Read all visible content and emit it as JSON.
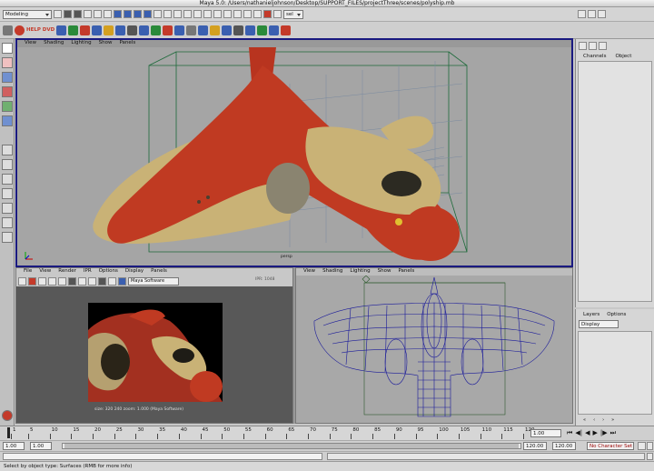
{
  "window": {
    "title": "Maya 5.0: /Users/nathanieljohnson/Desktop/SUPPORT_FILES/projectThree/scenes/polyship.mb"
  },
  "status_line": {
    "mode": "Modeling",
    "select_field": "sel"
  },
  "shelf": {
    "label": "HELP DVD"
  },
  "persp_panel": {
    "menus": [
      "View",
      "Shading",
      "Lighting",
      "Show",
      "Panels"
    ],
    "camera_label": "persp"
  },
  "render_panel": {
    "menus": [
      "File",
      "View",
      "Render",
      "IPR",
      "Options",
      "Display",
      "Panels"
    ],
    "renderer": "Maya Software",
    "ipr_label": "IPR: 1048",
    "caption": "size: 320 240 zoom: 1.000 (Maya Software)"
  },
  "front_panel": {
    "menus": [
      "View",
      "Shading",
      "Lighting",
      "Show",
      "Panels"
    ]
  },
  "channel_box": {
    "tabs": [
      "Channels",
      "Object"
    ]
  },
  "layers": {
    "tabs": [
      "Layers",
      "Options"
    ],
    "display": "Display"
  },
  "timeline": {
    "ticks": [
      "1",
      "5",
      "10",
      "15",
      "20",
      "25",
      "30",
      "35",
      "40",
      "45",
      "50",
      "55",
      "60",
      "65",
      "70",
      "75",
      "80",
      "85",
      "90",
      "95",
      "100",
      "105",
      "110",
      "115",
      "120"
    ],
    "current_frame": "1.00"
  },
  "range": {
    "start": "1.00",
    "inner_start": "1.00",
    "inner_end": "120.00",
    "end": "120.00",
    "char_set": "No Character Set"
  },
  "help_line": "Select by object type: Surfaces (RMB for more info)",
  "colors": {
    "active_border": "#1a1a80",
    "ship_red": "#c03a22",
    "ship_tan": "#c9b276",
    "wire": "#1a1a9a"
  }
}
